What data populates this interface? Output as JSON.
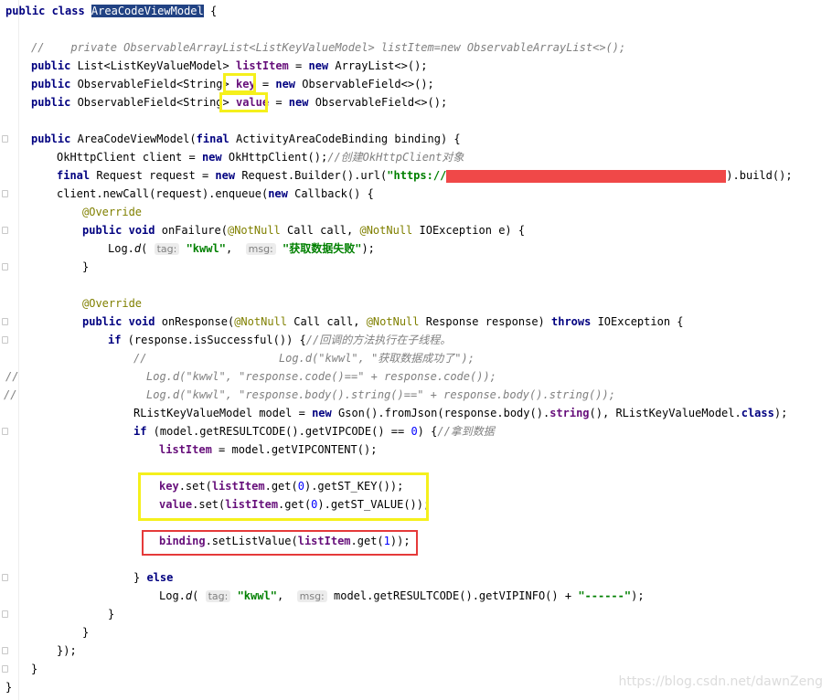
{
  "code": {
    "l01": {
      "kw1": "public class ",
      "cls": "AreaCodeViewModel",
      "rest": " {"
    },
    "l03": {
      "text": "//    private ObservableArrayList<ListKeyValueModel> listItem=new ObservableArrayList<>();"
    },
    "l04": {
      "kw": "public",
      "a": " List<ListKeyValueModel> ",
      "f": "listItem",
      "b": " = ",
      "kw2": "new",
      "c": " ArrayList<>();"
    },
    "l05": {
      "kw": "public",
      "a": " ObservableField<String> ",
      "f": "key",
      "b": " = ",
      "kw2": "new",
      "c": " ObservableField<>();"
    },
    "l06": {
      "kw": "public",
      "a": " ObservableField<String> ",
      "f": "value",
      "b": " = ",
      "kw2": "new",
      "c": " ObservableField<>();"
    },
    "l08": {
      "kw": "public",
      "a": " AreaCodeViewModel(",
      "kw2": "final",
      "b": " ActivityAreaCodeBinding binding) {"
    },
    "l09": {
      "a": "OkHttpClient client = ",
      "kw": "new",
      "b": " OkHttpClient();",
      "cmt": "//创建OkHttpClient对象"
    },
    "l10": {
      "kw": "final",
      "a": " Request request = ",
      "kw2": "new",
      "b": " Request.Builder().url(",
      "str": "\"https://",
      "c": ").build();"
    },
    "l11": {
      "a": "client.newCall(request).enqueue(",
      "kw": "new",
      "b": " Callback() {"
    },
    "l12": {
      "ann": "@Override"
    },
    "l13": {
      "kw": "public",
      "sp": " ",
      "kw2": "void",
      "a": " onFailure(",
      "ann": "@NotNull",
      "b": " Call call, ",
      "ann2": "@NotNull",
      "c": " IOException e) {"
    },
    "l14": {
      "a": "Log.",
      "fn": "d",
      "b": "( ",
      "hint1": "tag:",
      "s1": "\"kwwl\"",
      "c": ",  ",
      "hint2": "msg:",
      "s2": "\"获取数据失败\"",
      "d": ");"
    },
    "l15": {
      "text": "}"
    },
    "l17": {
      "ann": "@Override"
    },
    "l18": {
      "kw": "public",
      "sp": " ",
      "kw2": "void",
      "a": " onResponse(",
      "ann": "@NotNull",
      "b": " Call call, ",
      "ann2": "@NotNull",
      "c": " Response response) ",
      "kw3": "throws",
      "d": " IOException {"
    },
    "l19": {
      "kw": "if",
      "a": " (response.isSuccessful()) {",
      "cmt": "//回调的方法执行在子线程。"
    },
    "l20": {
      "text": "//                    Log.d(\"kwwl\", \"获取数据成功了\");"
    },
    "l21": {
      "text": "Log.d(\"kwwl\", \"response.code()==\" + response.code());"
    },
    "l22": {
      "text": "Log.d(\"kwwl\", \"response.body().string()==\" + response.body().string());"
    },
    "l23": {
      "a": "RListKeyValueModel model = ",
      "kw": "new",
      "b": " Gson().fromJson(response.body().",
      "f": "string",
      "c": "(), RListKeyValueModel.",
      "kw2": "class",
      "d": ");"
    },
    "l24": {
      "kw": "if",
      "a": " (model.getRESULTCODE().getVIPCODE() == ",
      "num": "0",
      "b": ") {",
      "cmt": "//拿到数据"
    },
    "l25": {
      "f": "listItem",
      "a": " = model.getVIPCONTENT();"
    },
    "l27": {
      "f": "key",
      "a": ".set(",
      "f2": "listItem",
      "b": ".get(",
      "num": "0",
      "c": ").getST_KEY());"
    },
    "l28": {
      "f": "value",
      "a": ".set(",
      "f2": "listItem",
      "b": ".get(",
      "num": "0",
      "c": ").getST_VALUE());"
    },
    "l30": {
      "f": "binding",
      "a": ".setListValue(",
      "f2": "listItem",
      "b": ".get(",
      "num": "1",
      "c": "));"
    },
    "l32": {
      "a": "} ",
      "kw": "else"
    },
    "l33": {
      "a": "Log.",
      "fn": "d",
      "b": "( ",
      "hint1": "tag:",
      "s1": "\"kwwl\"",
      "c": ",  ",
      "hint2": "msg:",
      "d": " model.getRESULTCODE().getVIPINFO() + ",
      "s2": "\"------\"",
      "e": ");"
    },
    "l34": {
      "text": "}"
    },
    "l35": {
      "text": "}"
    },
    "l36": {
      "text": "});"
    },
    "l37": {
      "text": "}"
    },
    "l38": {
      "text": "}"
    }
  },
  "gutter_marks": {
    "m21": "//",
    "m22": "//"
  },
  "watermark": "https://blog.csdn.net/dawnZeng"
}
